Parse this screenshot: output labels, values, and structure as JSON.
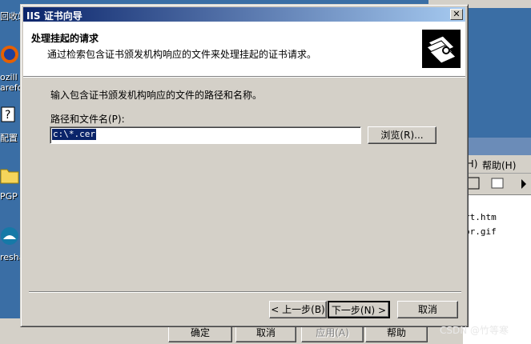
{
  "desktop": {
    "labels": [
      "回收站",
      "ozill",
      "arefo",
      "配置",
      "PGP",
      "resha"
    ]
  },
  "wizard": {
    "title": "IIS 证书向导",
    "close_glyph": "✕",
    "header_title": "处理挂起的请求",
    "header_subtitle": "通过检索包含证书颁发机构响应的文件来处理挂起的证书请求。",
    "instruction": "输入包含证书颁发机构响应的文件的路径和名称。",
    "path_label": "路径和文件名(P):",
    "path_value": "c:\\*.cer",
    "browse_label": "浏览(R)...",
    "back_label": "< 上一步(B)",
    "next_label": "下一步(N) >",
    "cancel_label": "取消",
    "header_icon": "certificate-icon"
  },
  "background_window": {
    "menu_h": "(H)",
    "menu_help": "帮助(H)",
    "files": [
      "rt.htm",
      "or.gif"
    ]
  },
  "underlying_dialog": {
    "ok_label": "确定",
    "cancel_label": "取消",
    "apply_label": "应用(A)",
    "help_label": "帮助"
  },
  "watermark": "CSDN @竹等寒"
}
